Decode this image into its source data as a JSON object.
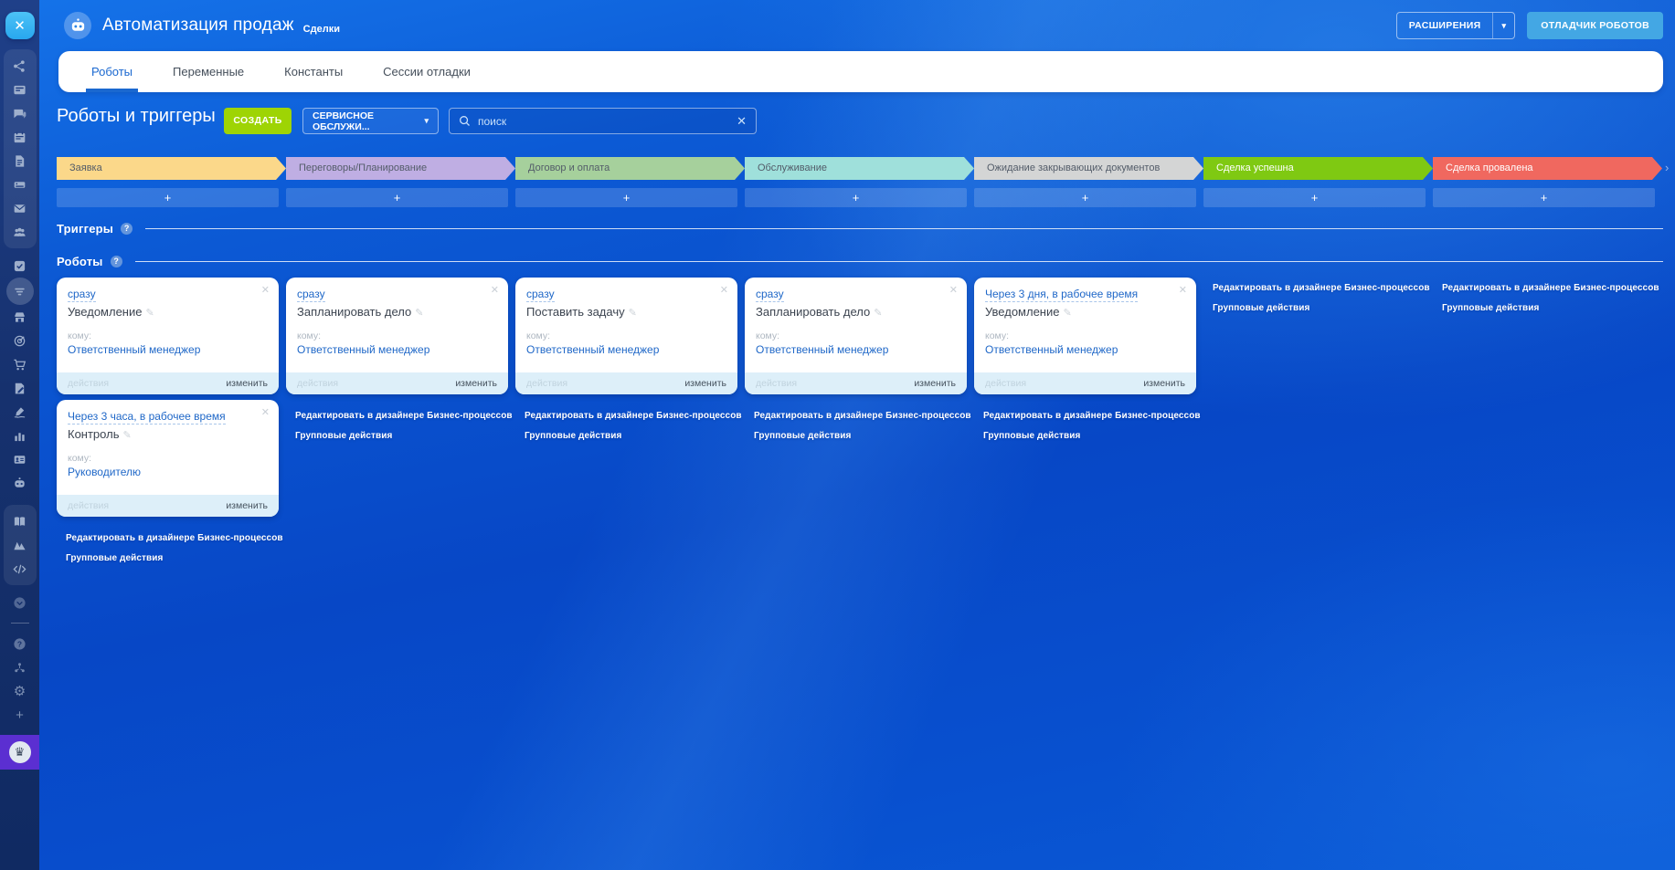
{
  "header": {
    "title": "Автоматизация продаж",
    "subtitle": "Сделки",
    "extensions_button": "РАСШИРЕНИЯ",
    "debugger_button": "ОТЛАДЧИК РОБОТОВ"
  },
  "tabs": {
    "robots": "Роботы",
    "variables": "Переменные",
    "constants": "Константы",
    "debug_sessions": "Сессии отладки"
  },
  "toolbar": {
    "heading": "Роботы и триггеры",
    "create_button": "СОЗДАТЬ",
    "funnel_selector": "СЕРВИСНОЕ ОБСЛУЖИ...",
    "search_placeholder": "поиск"
  },
  "stages": {
    "labels": [
      "Заявка",
      "Переговоры/Планирование",
      "Договор и оплата",
      "Обслуживание",
      "Ожидание закрывающих документов",
      "Сделка успешна",
      "Сделка провалена"
    ],
    "colors": [
      "#fbd88a",
      "#bfaee3",
      "#a6d09c",
      "#9fe0db",
      "#d4d5d5",
      "#7fc912",
      "#f0685f"
    ],
    "add_button": "+"
  },
  "sections": {
    "triggers": "Триггеры",
    "robots": "Роботы"
  },
  "cards": [
    {
      "when": "сразу",
      "name": "Уведомление",
      "to_label": "кому:",
      "to": "Ответственный менеджер"
    },
    {
      "when": "сразу",
      "name": "Запланировать дело",
      "to_label": "кому:",
      "to": "Ответственный менеджер"
    },
    {
      "when": "сразу",
      "name": "Поставить задачу",
      "to_label": "кому:",
      "to": "Ответственный менеджер"
    },
    {
      "when": "сразу",
      "name": "Запланировать дело",
      "to_label": "кому:",
      "to": "Ответственный менеджер"
    },
    {
      "when": "Через 3 дня, в рабочее время",
      "name": "Уведомление",
      "to_label": "кому:",
      "to": "Ответственный менеджер"
    },
    {
      "when": "Через 3 часа, в рабочее время",
      "name": "Контроль",
      "to_label": "кому:",
      "to": "Руководителю"
    }
  ],
  "card_footer": {
    "actions": "действия",
    "edit": "изменить"
  },
  "column_links": {
    "edit_designer": "Редактировать в дизайнере Бизнес-процессов",
    "group_actions": "Групповые действия"
  },
  "sidebar_icons": [
    "close",
    "live-feed",
    "tasks-board",
    "messenger",
    "calendar",
    "documents",
    "drive",
    "mail",
    "groups",
    "tasks-check",
    "crm-funnel",
    "market",
    "target",
    "shop-cart",
    "document-edit",
    "sign",
    "bi-chart",
    "contact-card",
    "robots",
    "knowledge-base",
    "sites",
    "developer",
    "more-chevron",
    "help",
    "network-hub",
    "settings-gear",
    "add-plus",
    "plan-crown"
  ],
  "colors": {
    "accent_blue": "#1a68d0",
    "create_green": "#9ed404",
    "debugger_blue": "#43a7e4",
    "success_green": "#7fc912",
    "failed_red": "#f0685f",
    "card_link_blue": "#2068c8",
    "crown_purple": "#5b2fd1",
    "card_footer_bg": "#ddeff9"
  }
}
